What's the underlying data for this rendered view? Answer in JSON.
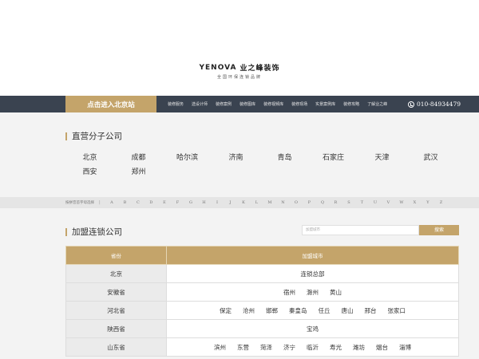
{
  "logo": {
    "en": "YENOVA",
    "cn": "业之峰装饰",
    "sub": "全国环保连锁品牌"
  },
  "nav": {
    "cta": "点击进入北京站",
    "links": [
      "装修服务",
      "选设计师",
      "装修案例",
      "装修图库",
      "装修视频库",
      "装修现场",
      "实景案例库",
      "装修攻略",
      "了解业之峰"
    ],
    "phone": "010-84934479"
  },
  "direct": {
    "title": "直营分子公司",
    "cities": [
      "北京",
      "成都",
      "哈尔滨",
      "济南",
      "青岛",
      "石家庄",
      "天津",
      "武汉",
      "西安",
      "郑州"
    ]
  },
  "alpha": {
    "label": "按拼音首字母选择",
    "sep": "|",
    "letters": [
      "A",
      "B",
      "C",
      "D",
      "E",
      "F",
      "G",
      "H",
      "I",
      "J",
      "K",
      "L",
      "M",
      "N",
      "O",
      "P",
      "Q",
      "R",
      "S",
      "T",
      "U",
      "V",
      "W",
      "X",
      "Y",
      "Z"
    ]
  },
  "franchise": {
    "title": "加盟连锁公司",
    "search_placeholder": "加盟城市",
    "search_button": "搜索",
    "headers": {
      "province": "省份",
      "city": "加盟城市"
    },
    "rows": [
      {
        "province": "北京",
        "cities": [
          "连锁总部"
        ]
      },
      {
        "province": "安徽省",
        "cities": [
          "宿州",
          "滁州",
          "黄山"
        ]
      },
      {
        "province": "河北省",
        "cities": [
          "保定",
          "沧州",
          "邯郸",
          "秦皇岛",
          "任丘",
          "唐山",
          "邢台",
          "张家口"
        ]
      },
      {
        "province": "陕西省",
        "cities": [
          "宝鸡"
        ]
      },
      {
        "province": "山东省",
        "cities": [
          "滨州",
          "东营",
          "菏泽",
          "济宁",
          "临沂",
          "寿光",
          "潍坊",
          "烟台",
          "淄博"
        ]
      }
    ]
  }
}
